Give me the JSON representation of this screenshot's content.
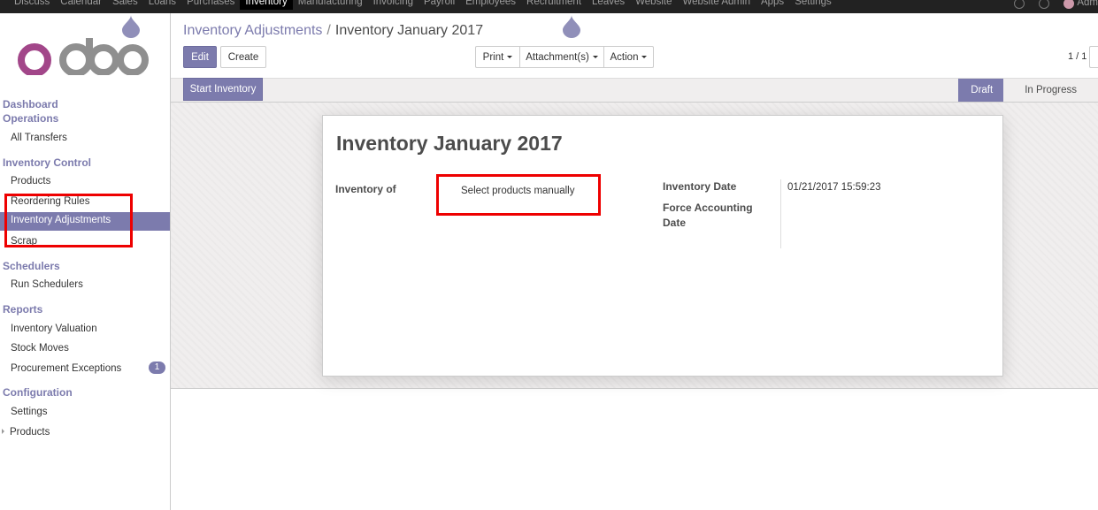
{
  "topbar": {
    "menu": [
      "Discuss",
      "Calendar",
      "Sales",
      "Loans",
      "Purchases",
      "Inventory",
      "Manufacturing",
      "Invoicing",
      "Payroll",
      "Employees",
      "Recruitment",
      "Leaves",
      "Website",
      "Website Admin",
      "Apps",
      "Settings"
    ],
    "active_index": 5,
    "user": "Adm"
  },
  "sidebar": {
    "dashboard": "Dashboard",
    "operations": "Operations",
    "all_transfers": "All Transfers",
    "inventory_control": "Inventory Control",
    "products": "Products",
    "reordering_rules": "Reordering Rules",
    "inventory_adjustments": "Inventory Adjustments",
    "scrap": "Scrap",
    "schedulers": "Schedulers",
    "run_schedulers": "Run Schedulers",
    "reports": "Reports",
    "inventory_valuation": "Inventory Valuation",
    "stock_moves": "Stock Moves",
    "procurement_exceptions": "Procurement Exceptions",
    "procurement_badge": "1",
    "configuration": "Configuration",
    "settings": "Settings",
    "config_products": "Products"
  },
  "breadcrumb": {
    "parent": "Inventory Adjustments",
    "separator": "/",
    "current": "Inventory January 2017"
  },
  "buttons": {
    "edit": "Edit",
    "create": "Create",
    "print": "Print",
    "attachments": "Attachment(s)",
    "action": "Action",
    "start_inventory": "Start Inventory"
  },
  "pager": "1 / 1",
  "status": {
    "draft": "Draft",
    "in_progress": "In Progress"
  },
  "form": {
    "title": "Inventory January 2017",
    "inventory_of_label": "Inventory of",
    "inventory_of_value": "Select products manually",
    "inventory_date_label": "Inventory Date",
    "inventory_date_value": "01/21/2017 15:59:23",
    "force_date_label_1": "Force Accounting",
    "force_date_label_2": "Date"
  },
  "colors": {
    "brand": "#7c7bad",
    "highlight": "#ee0000"
  }
}
